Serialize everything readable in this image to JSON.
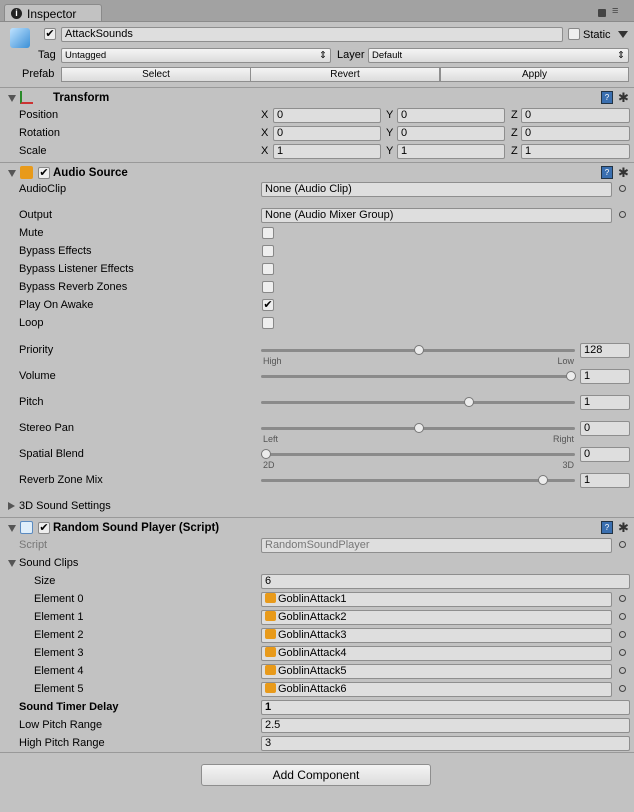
{
  "tab": {
    "title": "Inspector"
  },
  "object": {
    "name": "AttackSounds",
    "active": true,
    "static_label": "Static",
    "static": false,
    "tag_label": "Tag",
    "tag": "Untagged",
    "layer_label": "Layer",
    "layer": "Default",
    "prefab_label": "Prefab",
    "prefab_buttons": [
      "Select",
      "Revert",
      "Apply"
    ]
  },
  "transform": {
    "title": "Transform",
    "rows": [
      {
        "label": "Position",
        "x": "0",
        "y": "0",
        "z": "0"
      },
      {
        "label": "Rotation",
        "x": "0",
        "y": "0",
        "z": "0"
      },
      {
        "label": "Scale",
        "x": "1",
        "y": "1",
        "z": "1"
      }
    ]
  },
  "audio_source": {
    "title": "Audio Source",
    "enabled": true,
    "audioclip": {
      "label": "AudioClip",
      "value": "None (Audio Clip)"
    },
    "output": {
      "label": "Output",
      "value": "None (Audio Mixer Group)"
    },
    "toggles": [
      {
        "label": "Mute",
        "checked": false
      },
      {
        "label": "Bypass Effects",
        "checked": false
      },
      {
        "label": "Bypass Listener Effects",
        "checked": false
      },
      {
        "label": "Bypass Reverb Zones",
        "checked": false
      },
      {
        "label": "Play On Awake",
        "checked": true
      },
      {
        "label": "Loop",
        "checked": false
      }
    ],
    "sliders": [
      {
        "label": "Priority",
        "value": "128",
        "fraction": 0.5,
        "min_label": "High",
        "max_label": "Low"
      },
      {
        "label": "Volume",
        "value": "1",
        "fraction": 1
      },
      {
        "label": "Pitch",
        "value": "1",
        "fraction": 0.667
      },
      {
        "label": "Stereo Pan",
        "value": "0",
        "fraction": 0.5,
        "min_label": "Left",
        "max_label": "Right"
      },
      {
        "label": "Spatial Blend",
        "value": "0",
        "fraction": 0,
        "min_label": "2D",
        "max_label": "3D"
      },
      {
        "label": "Reverb Zone Mix",
        "value": "1",
        "fraction": 0.909
      }
    ],
    "sound_settings_label": "3D Sound Settings"
  },
  "random_sound_player": {
    "title": "Random Sound Player (Script)",
    "enabled": true,
    "script_label": "Script",
    "script": "RandomSoundPlayer",
    "sound_clips_label": "Sound Clips",
    "size_label": "Size",
    "size": "6",
    "elements": [
      {
        "label": "Element 0",
        "value": "GoblinAttack1"
      },
      {
        "label": "Element 1",
        "value": "GoblinAttack2"
      },
      {
        "label": "Element 2",
        "value": "GoblinAttack3"
      },
      {
        "label": "Element 3",
        "value": "GoblinAttack4"
      },
      {
        "label": "Element 4",
        "value": "GoblinAttack5"
      },
      {
        "label": "Element 5",
        "value": "GoblinAttack6"
      }
    ],
    "fields": [
      {
        "label": "Sound Timer Delay",
        "value": "1",
        "bold": true
      },
      {
        "label": "Low Pitch Range",
        "value": "2.5"
      },
      {
        "label": "High Pitch Range",
        "value": "3"
      }
    ]
  },
  "add_component": "Add Component",
  "icons": {
    "tab": "info-icon",
    "lock": "lock-icon",
    "menu": "menu-icon",
    "object": "cube-icon",
    "transform": "transform-axes-icon",
    "audio": "speaker-icon",
    "script": "csharp-script-icon",
    "help": "help-book-icon",
    "settings": "gear-icon"
  }
}
